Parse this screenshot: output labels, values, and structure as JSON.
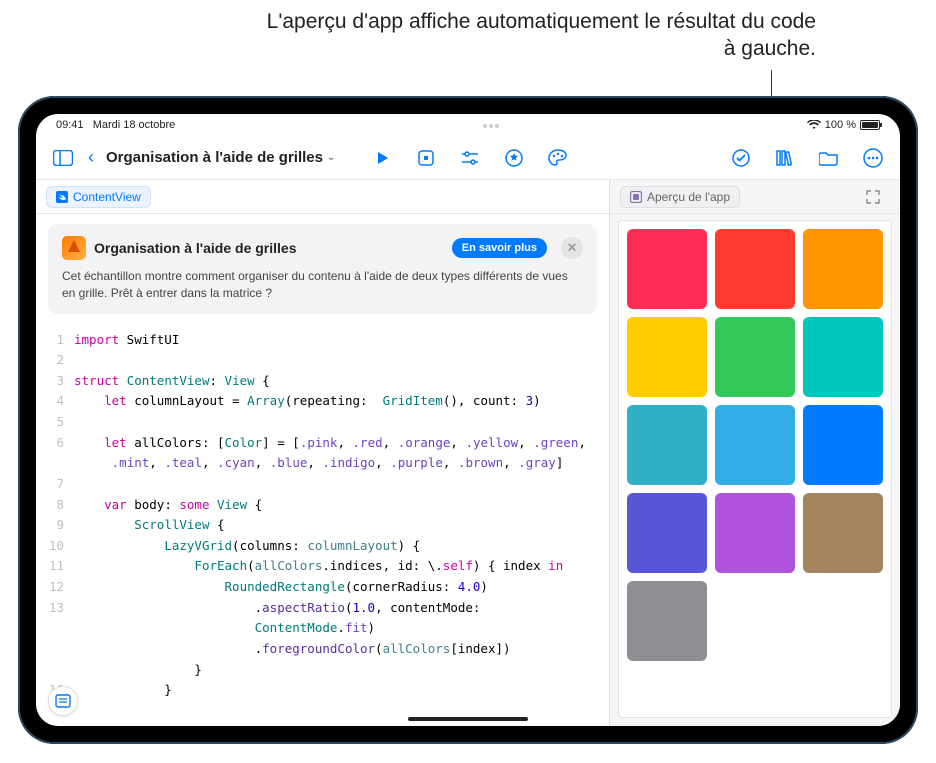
{
  "annotation": "L'aperçu d'app affiche automatiquement le résultat du code à gauche.",
  "status": {
    "time": "09:41",
    "date": "Mardi 18 octobre",
    "battery": "100 %"
  },
  "toolbar": {
    "title": "Organisation à l'aide de grilles"
  },
  "tabs": {
    "editor": "ContentView",
    "preview": "Aperçu de l'app"
  },
  "info": {
    "title": "Organisation à l'aide de grilles",
    "learn_more": "En savoir plus",
    "desc": "Cet échantillon montre comment organiser du contenu à l'aide de deux types différents de vues en grille. Prêt à entrer dans la matrice ?"
  },
  "code": [
    {
      "n": "1",
      "h": "<span class='kw'>import</span> SwiftUI"
    },
    {
      "n": "2",
      "h": ""
    },
    {
      "n": "3",
      "h": "<span class='kw'>struct</span> <span class='type'>ContentView</span>: <span class='type'>View</span> {"
    },
    {
      "n": "4",
      "h": "    <span class='kw'>let</span> columnLayout = <span class='type'>Array</span>(repeating:  <span class='type'>GridItem</span>(), count: <span class='num'>3</span>)"
    },
    {
      "n": "5",
      "h": ""
    },
    {
      "n": "6",
      "h": "    <span class='kw'>let</span> allColors: [<span class='type'>Color</span>] = [<span class='enum'>.pink</span>, <span class='enum'>.red</span>, <span class='enum'>.orange</span>, <span class='enum'>.yellow</span>, <span class='enum'>.green</span>,"
    },
    {
      "n": "",
      "h": "     <span class='enum'>.mint</span>, <span class='enum'>.teal</span>, <span class='enum'>.cyan</span>, <span class='enum'>.blue</span>, <span class='enum'>.indigo</span>, <span class='enum'>.purple</span>, <span class='enum'>.brown</span>, <span class='enum'>.gray</span>]"
    },
    {
      "n": "7",
      "h": ""
    },
    {
      "n": "8",
      "h": "    <span class='kw'>var</span> body: <span class='kw'>some</span> <span class='type'>View</span> {"
    },
    {
      "n": "9",
      "h": "        <span class='type'>ScrollView</span> {"
    },
    {
      "n": "10",
      "h": "            <span class='type'>LazyVGrid</span>(columns: <span class='id'>columnLayout</span>) {"
    },
    {
      "n": "11",
      "h": "                <span class='type'>ForEach</span>(<span class='id'>allColors</span>.indices, id: \\.<span class='kw'>self</span>) { index <span class='kw'>in</span>"
    },
    {
      "n": "12",
      "h": "                    <span class='type'>RoundedRectangle</span>(cornerRadius: <span class='num'>4.0</span>)"
    },
    {
      "n": "13",
      "h": "                        .<span class='fn'>aspectRatio</span>(<span class='num'>1.0</span>, contentMode:"
    },
    {
      "n": "",
      "h": "                        <span class='type'>ContentMode</span>.<span class='enum'>fit</span>)"
    },
    {
      "n": "",
      "h": "                        .<span class='fn'>foregroundColor</span>(<span class='id'>allColors</span>[index])"
    },
    {
      "n": "",
      "h": "                }"
    },
    {
      "n": "16",
      "h": "            }"
    }
  ],
  "preview_colors": [
    "#ff2d55",
    "#ff3b30",
    "#ff9500",
    "#ffcc00",
    "#34c759",
    "#00c7be",
    "#30b0c7",
    "#32ade6",
    "#007aff",
    "#5856d6",
    "#af52de",
    "#a2845e",
    "#8e8e93"
  ]
}
